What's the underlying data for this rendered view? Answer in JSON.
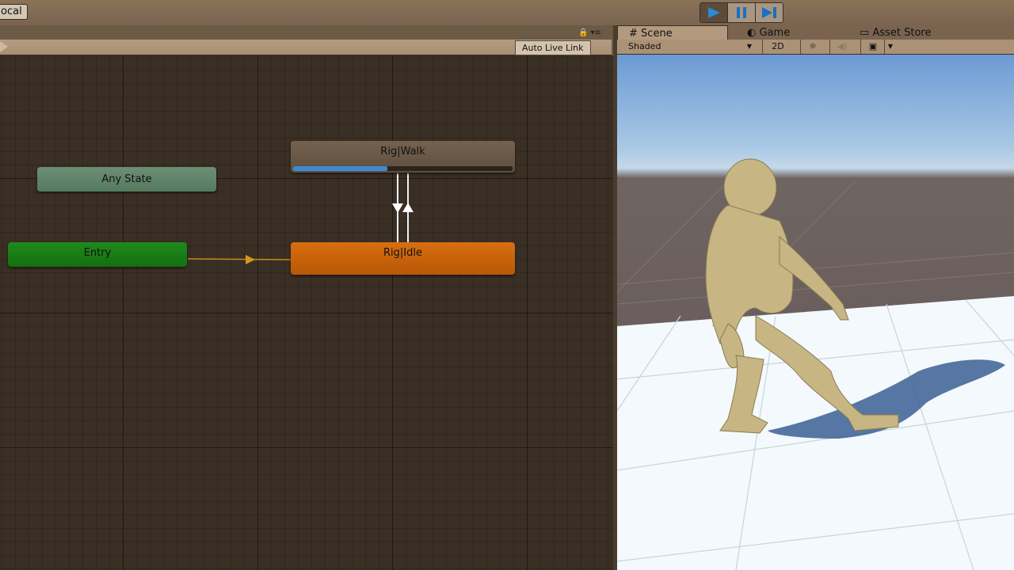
{
  "toolbar": {
    "pivot_label": "ocal",
    "play_icon": "play-icon",
    "pause_icon": "pause-icon",
    "step_icon": "step-icon"
  },
  "animator": {
    "live_link_label": "Auto Live Link",
    "states": {
      "any_state": "Any State",
      "entry": "Entry",
      "walk": "Rig|Walk",
      "idle": "Rig|Idle"
    },
    "walk_progress": 0.43,
    "colors": {
      "any_state": "#5f8568",
      "entry": "#1a7e16",
      "walk": "#6a5846",
      "idle": "#c9620b",
      "progress": "#3e8ad0",
      "transition_default": "#c98a1a"
    }
  },
  "scene": {
    "tabs": {
      "scene": "Scene",
      "game": "Game",
      "asset_store": "Asset Store"
    },
    "shading_mode": "Shaded",
    "mode_2d": "2D"
  }
}
